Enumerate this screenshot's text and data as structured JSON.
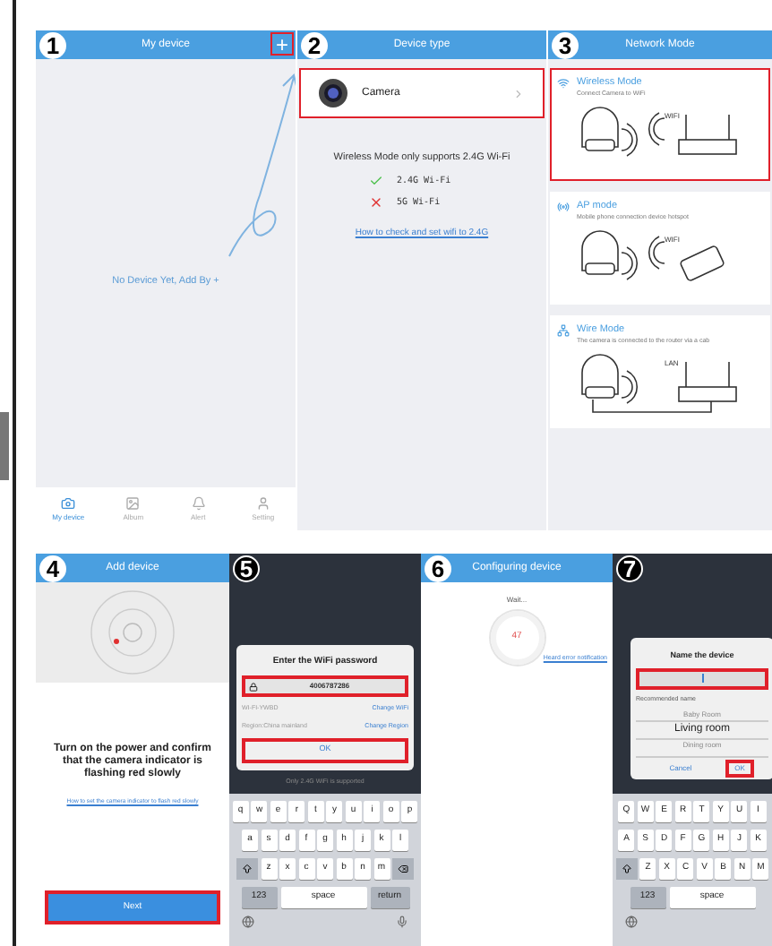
{
  "screen_1": {
    "badge": "1",
    "title": "My device",
    "add_button": {
      "label": "+",
      "highlighted": true
    },
    "empty_text": "No Device Yet, Add By +",
    "tabs": [
      {
        "label": "My device",
        "selected": true
      },
      {
        "label": "Album",
        "selected": false
      },
      {
        "label": "Alert",
        "selected": false
      },
      {
        "label": "Setting",
        "selected": false
      }
    ]
  },
  "screen_2": {
    "badge": "2",
    "title": "Device type",
    "device": {
      "label": "Camera",
      "highlighted": true
    },
    "notice": "Wireless Mode only supports 2.4G Wi-Fi",
    "bands": [
      {
        "label": "2.4G Wi-Fi",
        "supported": true
      },
      {
        "label": "5G Wi-Fi",
        "supported": false
      }
    ],
    "link": "How to check and set wifi to 2.4G"
  },
  "screen_3": {
    "badge": "3",
    "title": "Network Mode",
    "modes": [
      {
        "kind": "wireless",
        "name": "Wireless Mode",
        "description": "Connect Camera to WiFi",
        "tag": "WIFI",
        "highlighted": true
      },
      {
        "kind": "ap",
        "name": "AP mode",
        "description": "Mobile phone connection device hotspot",
        "tag": "WIFI",
        "highlighted": false
      },
      {
        "kind": "wire",
        "name": "Wire Mode",
        "description": "The camera is connected to the router via a cab",
        "tag": "LAN",
        "highlighted": false
      }
    ]
  },
  "screen_4": {
    "badge": "4",
    "title": "Add device",
    "instruction": "Turn on the power and confirm that the camera indicator is flashing red slowly",
    "link": "How to set the camera indicator to flash red slowly",
    "next_button": {
      "label": "Next",
      "highlighted": true
    }
  },
  "screen_5": {
    "badge": "5",
    "dialog_title": "Enter the WiFi password",
    "password": {
      "value": "4006787286",
      "highlighted": true
    },
    "wifi_name": "WI-FI-YWBD",
    "change_wifi": "Change WiFi",
    "region": "Region:China mainland",
    "change_region": "Change Region",
    "ok_button": {
      "label": "OK",
      "highlighted": true
    },
    "hint": "Only 2.4G WiFi is supported",
    "keyboard": {
      "top_keys": [
        "q",
        "w",
        "e",
        "r",
        "t",
        "y",
        "u",
        "i",
        "o",
        "p"
      ],
      "middle_keys": [
        "a",
        "s",
        "d",
        "f",
        "g",
        "h",
        "j",
        "k",
        "l"
      ],
      "bottom_keys": [
        "z",
        "x",
        "c",
        "v",
        "b",
        "n",
        "m"
      ],
      "numbers": "123",
      "space": "space",
      "return": "return"
    }
  },
  "screen_6": {
    "badge": "6",
    "title": "Configuring device",
    "status": "Wait...",
    "countdown": "47",
    "link": "Heard error notification"
  },
  "screen_7": {
    "badge": "7",
    "dialog_title": "Name the device",
    "name_field": {
      "highlighted": true
    },
    "recommended": "Recommended name",
    "names": [
      {
        "label": "Baby Room",
        "selected": false
      },
      {
        "label": "Living room",
        "selected": true
      },
      {
        "label": "Dining room",
        "selected": false
      }
    ],
    "cancel_button": "Cancel",
    "ok_button": {
      "label": "OK",
      "highlighted": true
    },
    "keyboard": {
      "top_keys": [
        "Q",
        "W",
        "E",
        "R",
        "T",
        "Y",
        "U",
        "I"
      ],
      "middle_keys": [
        "A",
        "S",
        "D",
        "F",
        "G",
        "H",
        "J",
        "K"
      ],
      "bottom_keys": [
        "Z",
        "X",
        "C",
        "V",
        "B",
        "N",
        "M"
      ],
      "numbers": "123",
      "space": "space"
    }
  }
}
